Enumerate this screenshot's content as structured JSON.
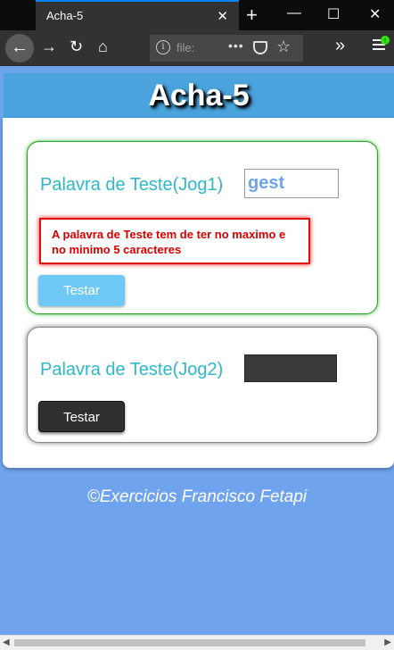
{
  "browser": {
    "tab_title": "Acha-5",
    "tab_close": "✕",
    "new_tab": "+",
    "window_controls": {
      "minimize": "—",
      "maximize": "☐",
      "close": "✕"
    },
    "nav": {
      "back": "←",
      "forward": "→",
      "reload": "↻",
      "home": "⌂"
    },
    "url_text": "file:",
    "url_more": "•••",
    "overflow": "»",
    "icons": [
      "back-arrow",
      "forward-arrow",
      "reload",
      "home",
      "info",
      "pocket",
      "star",
      "overflow-chevrons",
      "hamburger-menu"
    ]
  },
  "page": {
    "title": "Acha-5",
    "player1": {
      "label": "Palavra de Teste(Jog1)",
      "input_value": "gest",
      "error_message": "A palavra de Teste tem de ter no maximo e no minimo 5 caracteres",
      "button_label": "Testar"
    },
    "player2": {
      "label": "Palavra de Teste(Jog2)",
      "input_value": "",
      "button_label": "Testar"
    },
    "footer": "©Exercicios Francisco Fetapi"
  },
  "colors": {
    "background": "#6fa3ee",
    "header": "#4aa3dc",
    "label": "#2eb8c8",
    "error": "#d90000",
    "card1_border": "#2aa02a",
    "button1": "#6fc9f6",
    "button2": "#2f2f2f"
  }
}
